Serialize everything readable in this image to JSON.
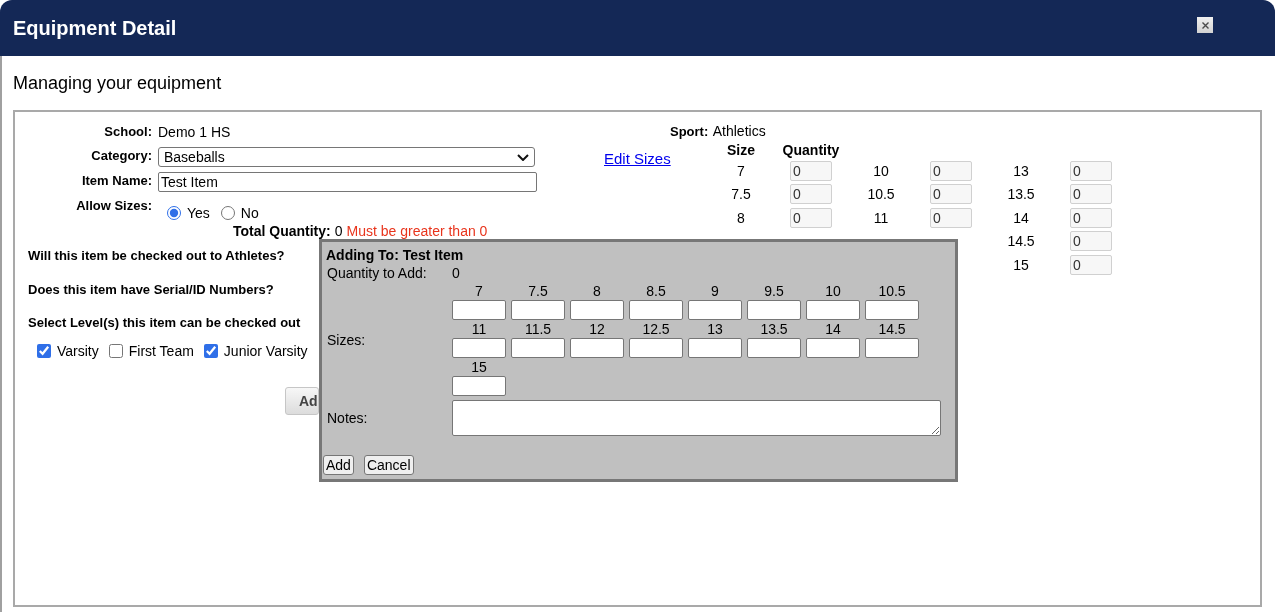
{
  "window": {
    "title": "Equipment Detail"
  },
  "heading": "Managing your equipment",
  "form": {
    "school": {
      "label": "School:",
      "value": "Demo 1 HS"
    },
    "category": {
      "label": "Category:",
      "value": "Baseballs"
    },
    "item_name": {
      "label": "Item Name:",
      "value": "Test Item"
    },
    "allow_sizes": {
      "label": "Allow Sizes:",
      "options": [
        {
          "label": "Yes",
          "selected": true
        },
        {
          "label": "No",
          "selected": false
        }
      ]
    },
    "total_quantity": {
      "label": "Total Quantity:",
      "value": "0",
      "error": "Must be greater than 0"
    },
    "questions": [
      "Will this item be checked out to Athletes?",
      "Does this item have Serial/ID Numbers?"
    ],
    "levels_prompt": "Select Level(s) this item can be checked out",
    "levels": [
      {
        "label": "Varsity",
        "checked": true
      },
      {
        "label": "First Team",
        "checked": false
      },
      {
        "label": "Junior Varsity",
        "checked": true
      }
    ],
    "submit_button": "Ad"
  },
  "sport": {
    "label": "Sport:",
    "value": "Athletics"
  },
  "edit_sizes_link": "Edit Sizes",
  "size_grid": {
    "headers": [
      "Size",
      "Quantity"
    ],
    "groups": [
      {
        "items": [
          {
            "size": "7",
            "quantity": "0",
            "disabled": true
          },
          {
            "size": "7.5",
            "quantity": "0",
            "disabled": true
          },
          {
            "size": "8",
            "quantity": "0",
            "disabled": true
          }
        ]
      },
      {
        "items": [
          {
            "size": "10",
            "quantity": "0",
            "disabled": true
          },
          {
            "size": "10.5",
            "quantity": "0",
            "disabled": true
          },
          {
            "size": "11",
            "quantity": "0",
            "disabled": true
          }
        ]
      },
      {
        "items": [
          {
            "size": "13",
            "quantity": "0",
            "disabled": true
          },
          {
            "size": "13.5",
            "quantity": "0",
            "disabled": true
          },
          {
            "size": "14",
            "quantity": "0",
            "disabled": true
          },
          {
            "size": "14.5",
            "quantity": "0",
            "disabled": true
          },
          {
            "size": "15",
            "quantity": "0",
            "disabled": true
          }
        ]
      }
    ]
  },
  "add_dialog": {
    "title": "Adding To: Test Item",
    "quantity_label": "Quantity to Add:",
    "quantity_value": "0",
    "sizes_label": "Sizes:",
    "sizes": [
      "7",
      "7.5",
      "8",
      "8.5",
      "9",
      "9.5",
      "10",
      "10.5",
      "11",
      "11.5",
      "12",
      "12.5",
      "13",
      "13.5",
      "14",
      "14.5",
      "15"
    ],
    "notes_label": "Notes:",
    "buttons": [
      "Add",
      "Cancel"
    ]
  }
}
